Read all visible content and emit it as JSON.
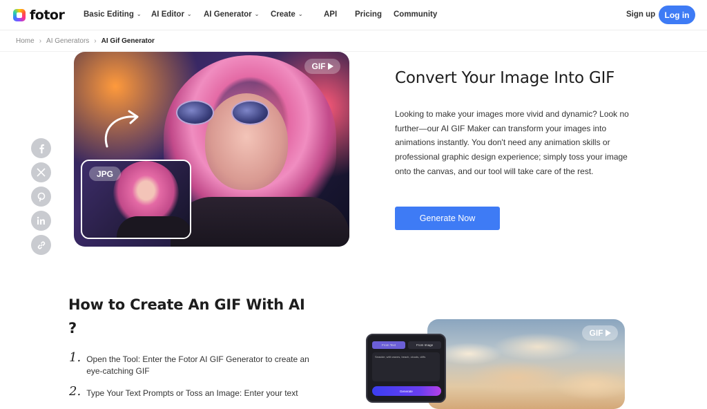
{
  "header": {
    "logo_text": "fotor",
    "nav": [
      {
        "label": "Basic Editing",
        "has_dropdown": true
      },
      {
        "label": "AI Editor",
        "has_dropdown": true
      },
      {
        "label": "AI Generator",
        "has_dropdown": true
      },
      {
        "label": "Create",
        "has_dropdown": true
      },
      {
        "label": "API",
        "has_dropdown": false
      },
      {
        "label": "Pricing",
        "has_dropdown": false
      },
      {
        "label": "Community",
        "has_dropdown": false
      }
    ],
    "signup_label": "Sign up",
    "login_label": "Log in"
  },
  "breadcrumb": {
    "items": [
      "Home",
      "AI Generators",
      "AI Gif Generator"
    ]
  },
  "hero": {
    "gif_badge": "GIF",
    "jpg_badge": "JPG",
    "title": "Convert Your Image Into GIF",
    "description": "Looking to make your images more vivid and dynamic? Look no further—our AI GIF Maker can transform your images into animations instantly. You don't need any animation skills or professional graphic design experience; simply toss your image onto the canvas, and our tool will take care of the rest.",
    "cta_label": "Generate Now"
  },
  "social": {
    "buttons": [
      "facebook-icon",
      "x-icon",
      "pinterest-icon",
      "linkedin-icon",
      "link-icon"
    ]
  },
  "how_to": {
    "title": "How to Create An GIF With AI ?",
    "steps": [
      {
        "num": "1.",
        "text": "Open the Tool: Enter the Fotor AI GIF Generator to create an eye-catching GIF"
      },
      {
        "num": "2.",
        "text": "Type Your Text Prompts or Toss an Image: Enter your text"
      }
    ]
  },
  "preview": {
    "phone_tab_text": "From Text",
    "phone_tab_image": "From Image",
    "phone_prompt": "Seaside, with waves, beach, clouds, cliffs",
    "phone_generate": "Generate",
    "sky_gif_badge": "GIF"
  },
  "colors": {
    "brand_blue": "#3e7bf5",
    "social_gray": "#c9cbd0"
  }
}
